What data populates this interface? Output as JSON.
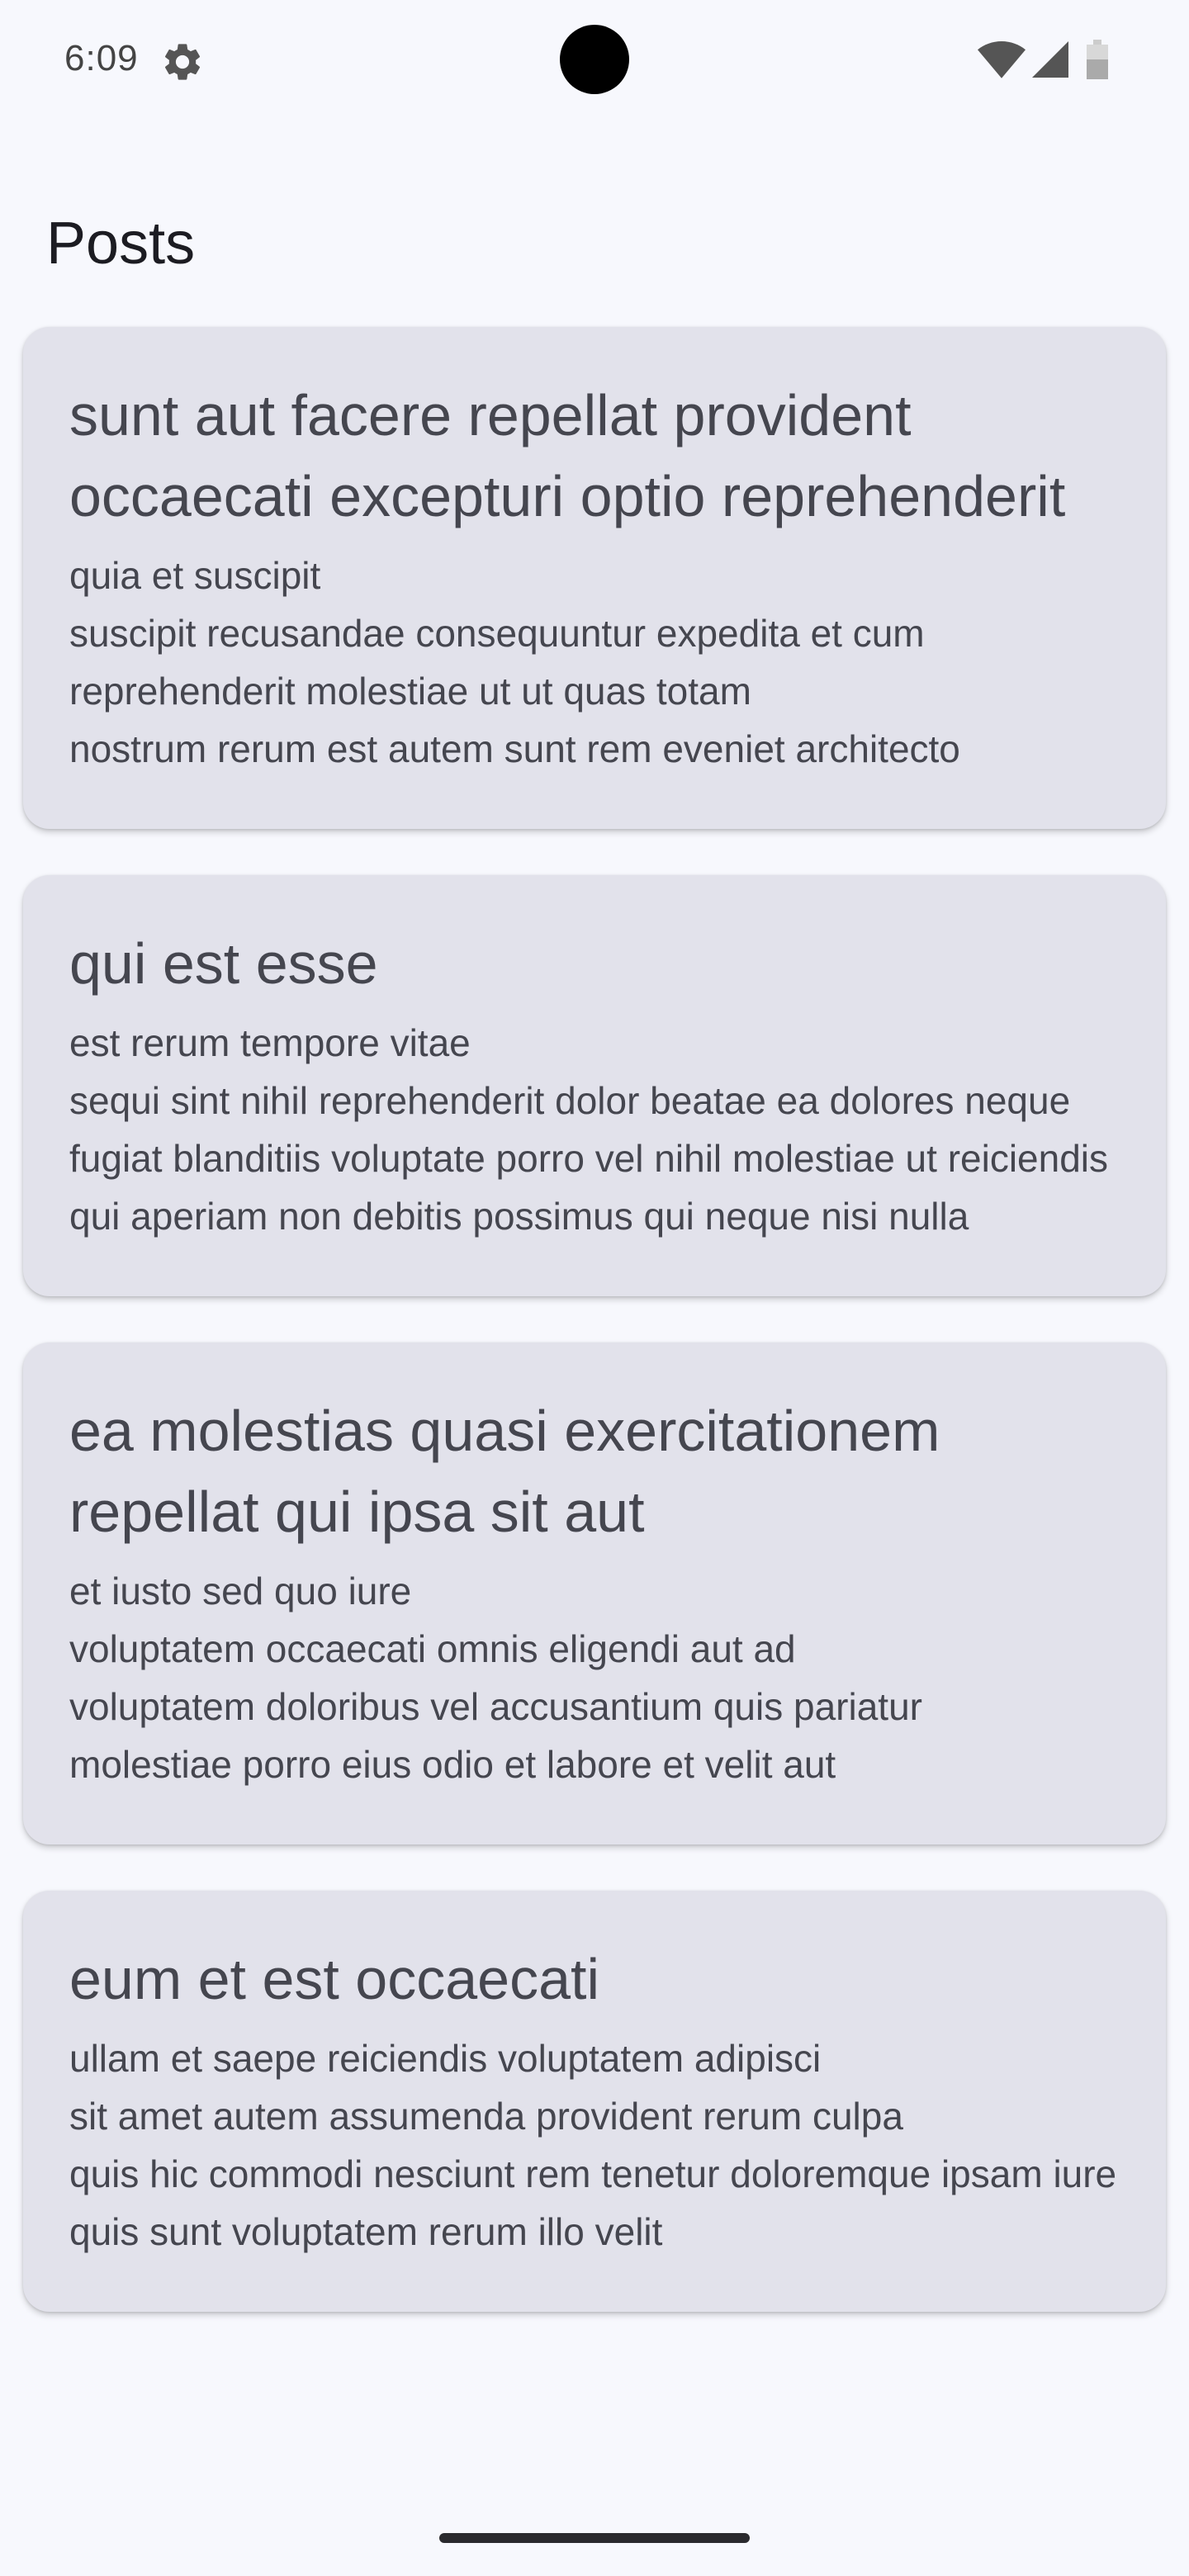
{
  "status_bar": {
    "time": "6:09",
    "icons": [
      "gear-icon",
      "camera-cutout",
      "wifi-icon",
      "cellular-icon",
      "battery-icon"
    ]
  },
  "header": {
    "title": "Posts"
  },
  "posts": [
    {
      "title": "sunt aut facere repellat provident occaecati excepturi optio reprehenderit",
      "body": "quia et suscipit\nsuscipit recusandae consequuntur expedita et cum reprehenderit molestiae ut ut quas totam\nnostrum rerum est autem sunt rem eveniet architecto"
    },
    {
      "title": "qui est esse",
      "body": "est rerum tempore vitae\nsequi sint nihil reprehenderit dolor beatae ea dolores neque\nfugiat blanditiis voluptate porro vel nihil molestiae ut reiciendis\nqui aperiam non debitis possimus qui neque nisi nulla"
    },
    {
      "title": "ea molestias quasi exercitationem repellat qui ipsa sit aut",
      "body": "et iusto sed quo iure\nvoluptatem occaecati omnis eligendi aut ad\nvoluptatem doloribus vel accusantium quis pariatur\nmolestiae porro eius odio et labore et velit aut"
    },
    {
      "title": "eum et est occaecati",
      "body": "ullam et saepe reiciendis voluptatem adipisci\nsit amet autem assumenda provident rerum culpa\nquis hic commodi nesciunt rem tenetur doloremque ipsam iure\nquis sunt voluptatem rerum illo velit"
    }
  ],
  "colors": {
    "background": "#f7f8fd",
    "card": "#e2e2eb",
    "text": "#45464f",
    "title": "#1c1c22"
  }
}
